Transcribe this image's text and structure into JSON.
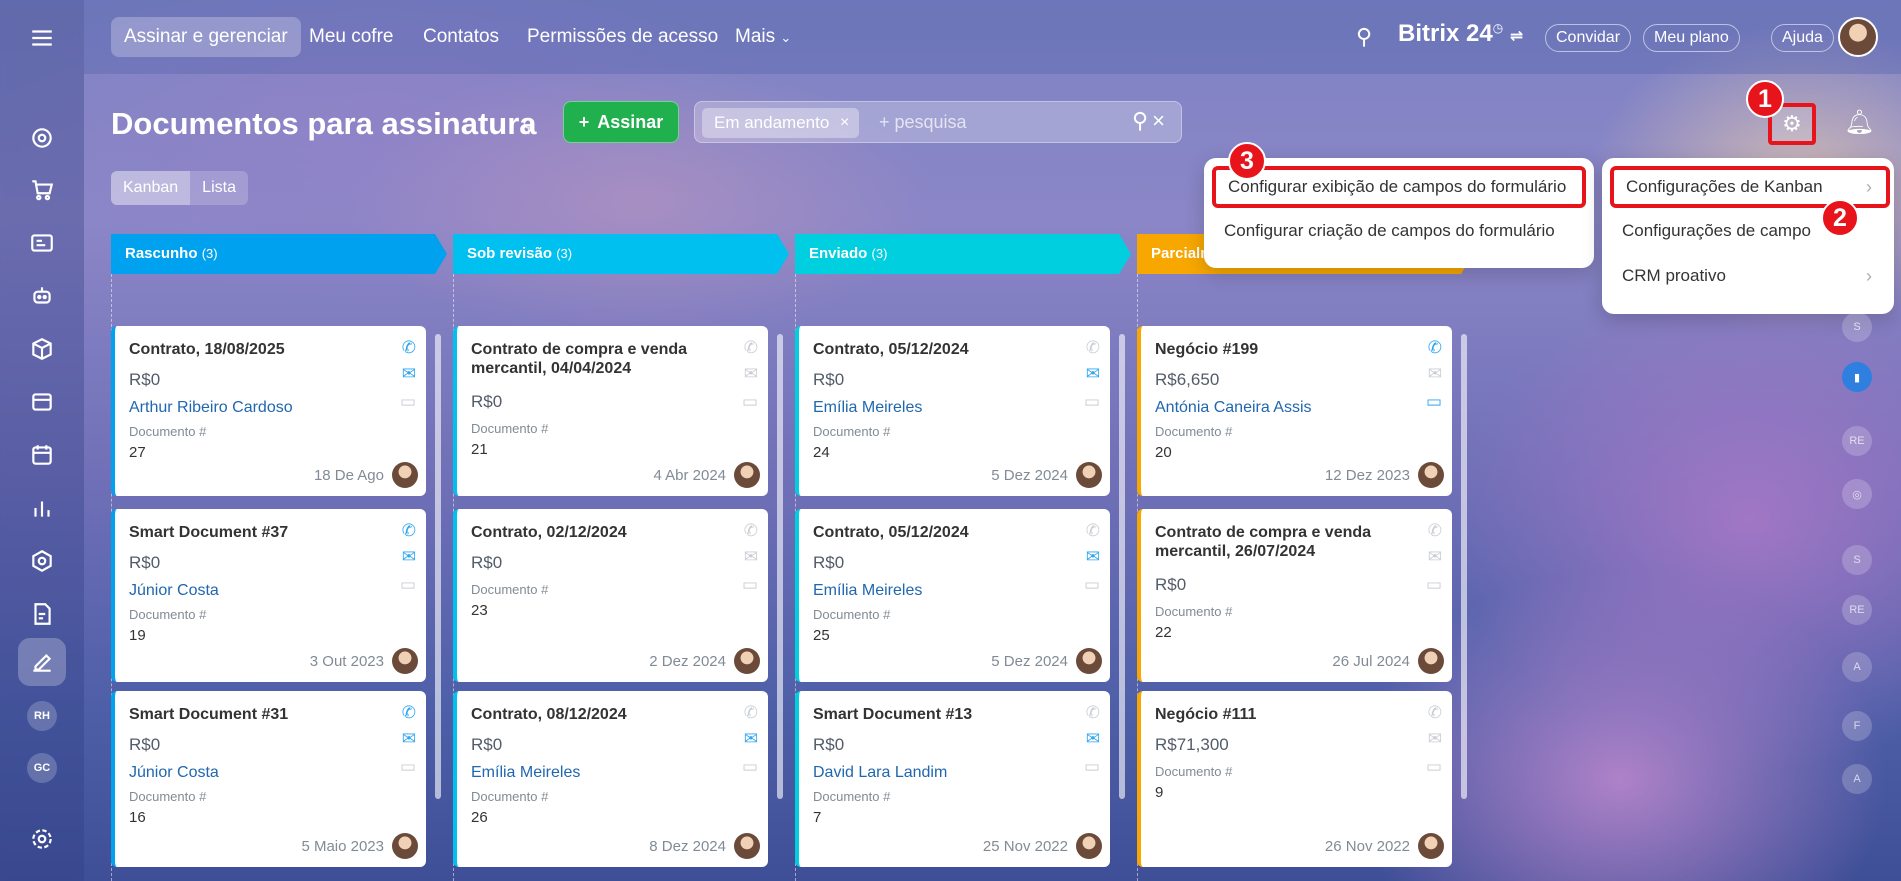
{
  "nav": {
    "items": [
      "Assinar e gerenciar",
      "Meu cofre",
      "Contatos",
      "Permissões de acesso",
      "Mais"
    ],
    "brand": "Bitrix 24",
    "invite": "Convidar",
    "plan": "Meu plano",
    "help": "Ajuda"
  },
  "rail": {
    "avatars": [
      "RH",
      "GC"
    ]
  },
  "header": {
    "title": "Documentos para assinatura",
    "sign_button": "Assinar",
    "filter_chip": "Em andamento",
    "search_placeholder": "+ pesquisa",
    "views": [
      "Kanban",
      "Lista"
    ]
  },
  "badges": [
    "1",
    "2",
    "3"
  ],
  "menu_left": {
    "items": [
      "Configurar exibição de campos do formulário",
      "Configurar criação de campos do formulário"
    ]
  },
  "menu_right": {
    "items": [
      "Configurações de Kanban",
      "Configurações de campo",
      "CRM proativo"
    ]
  },
  "right_rail_labels": [
    "S",
    "RE",
    "S",
    "RE",
    "A",
    "F",
    "A"
  ],
  "columns": [
    {
      "name": "Rascunho",
      "count": "(3)",
      "color": "#00a2f0",
      "cards": [
        {
          "title": "Contrato, 18/08/2025",
          "amount": "R$0",
          "contact": "Arthur Ribeiro Cardoso",
          "label": "Documento #",
          "num": "27",
          "date": "18 De Ago"
        },
        {
          "title": "Smart Document #37",
          "amount": "R$0",
          "contact": "Júnior Costa",
          "label": "Documento #",
          "num": "19",
          "date": "3 Out 2023"
        },
        {
          "title": "Smart Document #31",
          "amount": "R$0",
          "contact": "Júnior Costa",
          "label": "Documento #",
          "num": "16",
          "date": "5 Maio 2023"
        }
      ]
    },
    {
      "name": "Sob revisão",
      "count": "(3)",
      "color": "#00c0f0",
      "cards": [
        {
          "title": "Contrato de compra e venda mercantil, 04/04/2024",
          "amount": "R$0",
          "contact": "",
          "label": "Documento #",
          "num": "21",
          "date": "4 Abr 2024"
        },
        {
          "title": "Contrato, 02/12/2024",
          "amount": "R$0",
          "contact": "",
          "label": "Documento #",
          "num": "23",
          "date": "2 Dez 2024"
        },
        {
          "title": "Contrato, 08/12/2024",
          "amount": "R$0",
          "contact": "Emília Meireles",
          "label": "Documento #",
          "num": "26",
          "date": "8 Dez 2024"
        }
      ]
    },
    {
      "name": "Enviado",
      "count": "(3)",
      "color": "#00cfe0",
      "cards": [
        {
          "title": "Contrato, 05/12/2024",
          "amount": "R$0",
          "contact": "Emília Meireles",
          "label": "Documento #",
          "num": "24",
          "date": "5 Dez 2024"
        },
        {
          "title": "Contrato, 05/12/2024",
          "amount": "R$0",
          "contact": "Emília Meireles",
          "label": "Documento #",
          "num": "25",
          "date": "5 Dez 2024"
        },
        {
          "title": "Smart Document #13",
          "amount": "R$0",
          "contact": "David Lara Landim",
          "label": "Documento #",
          "num": "7",
          "date": "25 Nov 2022"
        }
      ]
    },
    {
      "name": "Parcialm",
      "count": "",
      "color": "#f7a700",
      "cards": [
        {
          "title": "Negócio #199",
          "amount": "R$6,650",
          "contact": "Antónia Caneira Assis",
          "label": "Documento #",
          "num": "20",
          "date": "12 Dez 2023"
        },
        {
          "title": "Contrato de compra e venda mercantil, 26/07/2024",
          "amount": "R$0",
          "contact": "",
          "label": "Documento #",
          "num": "22",
          "date": "26 Jul 2024"
        },
        {
          "title": "Negócio #111",
          "amount": "R$71,300",
          "contact": "",
          "label": "Documento #",
          "num": "9",
          "date": "26 Nov 2022"
        }
      ]
    }
  ]
}
